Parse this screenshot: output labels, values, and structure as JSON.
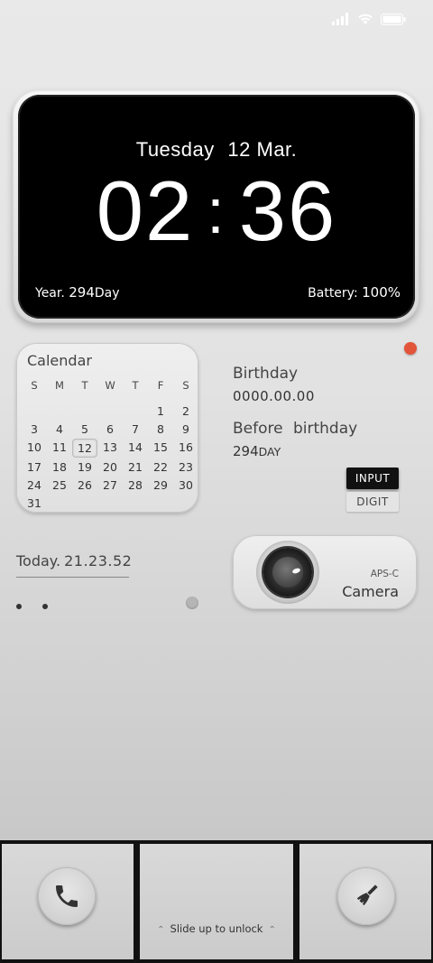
{
  "status_bar": {
    "icons": [
      "signal-icon",
      "wifi-icon",
      "battery-icon"
    ]
  },
  "clock": {
    "weekday": "Tuesday",
    "date": "12 Mar.",
    "hour": "02",
    "separator": ":",
    "minute": "36",
    "year_label": "Year.",
    "year_value": "294",
    "year_unit": "Day",
    "battery_label": "Battery:",
    "battery_value": "100%"
  },
  "calendar": {
    "title": "Calendar",
    "weekday_headers": [
      "S",
      "M",
      "T",
      "W",
      "T",
      "F",
      "S"
    ],
    "days": [
      "",
      "",
      "",
      "",
      "",
      "1",
      "2",
      "3",
      "4",
      "5",
      "6",
      "7",
      "8",
      "9",
      "10",
      "11",
      "12",
      "13",
      "14",
      "15",
      "16",
      "17",
      "18",
      "19",
      "20",
      "21",
      "22",
      "23",
      "24",
      "25",
      "26",
      "27",
      "28",
      "29",
      "30",
      "31"
    ],
    "today": "12"
  },
  "birthday": {
    "label": "Birthday",
    "value": "0000.00.00",
    "before_label": "Before birthday",
    "before_value": "294",
    "before_unit": "DAY",
    "input_button": "INPUT",
    "digit_button": "DIGIT"
  },
  "today": {
    "label": "Today.",
    "value": "21.23.52"
  },
  "camera": {
    "sensor": "APS-C",
    "label": "Camera"
  },
  "dock": {
    "unlock_text": "Slide up to unlock",
    "left_icon": "phone-icon",
    "right_icon": "broom-icon"
  },
  "colors": {
    "accent_dot": "#e2553a",
    "clock_background": "#000000",
    "page_background": "#e6e6e6"
  }
}
